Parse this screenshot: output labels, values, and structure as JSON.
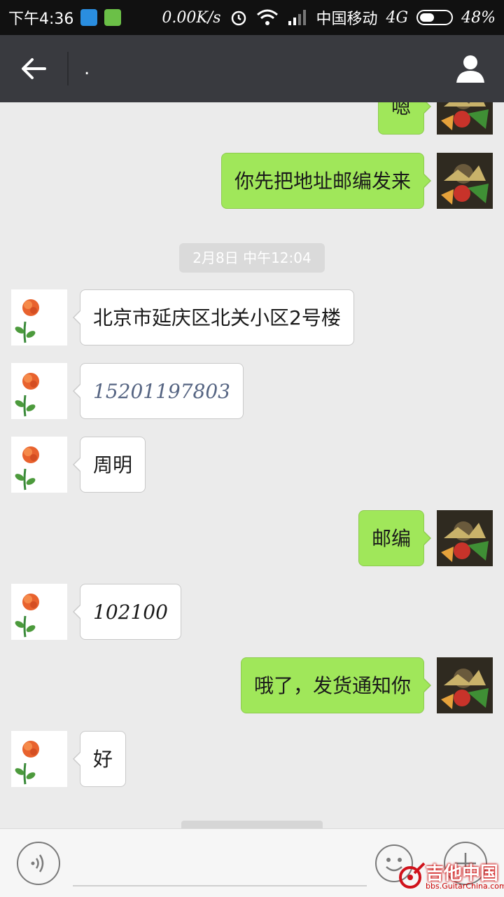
{
  "status_bar": {
    "time": "下午4:36",
    "net_speed": "0.00K/s",
    "carrier": "中国移动",
    "network": "4G",
    "battery": "48%",
    "battery_level": 0.48
  },
  "header": {
    "title": "."
  },
  "messages": [
    {
      "side": "right",
      "text": "嗯"
    },
    {
      "side": "right",
      "text": "你先把地址邮编发来"
    },
    {
      "timestamp": "2月8日 中午12:04"
    },
    {
      "side": "left",
      "text": "北京市延庆区北关小区2号楼"
    },
    {
      "side": "left",
      "text": "15201197803"
    },
    {
      "side": "left",
      "text": "周明"
    },
    {
      "side": "right",
      "text": "邮编"
    },
    {
      "side": "left",
      "text": "102100"
    },
    {
      "side": "right",
      "text": "哦了，发货通知你"
    },
    {
      "side": "left",
      "text": "好"
    }
  ],
  "watermark": {
    "main": "吉他中国",
    "sub": "bbs.GuitarChina.com"
  },
  "colors": {
    "sent_bubble": "#a0e75a",
    "received_bubble": "#ffffff",
    "header_bg": "#393a3f",
    "chat_bg": "#ebebeb"
  }
}
